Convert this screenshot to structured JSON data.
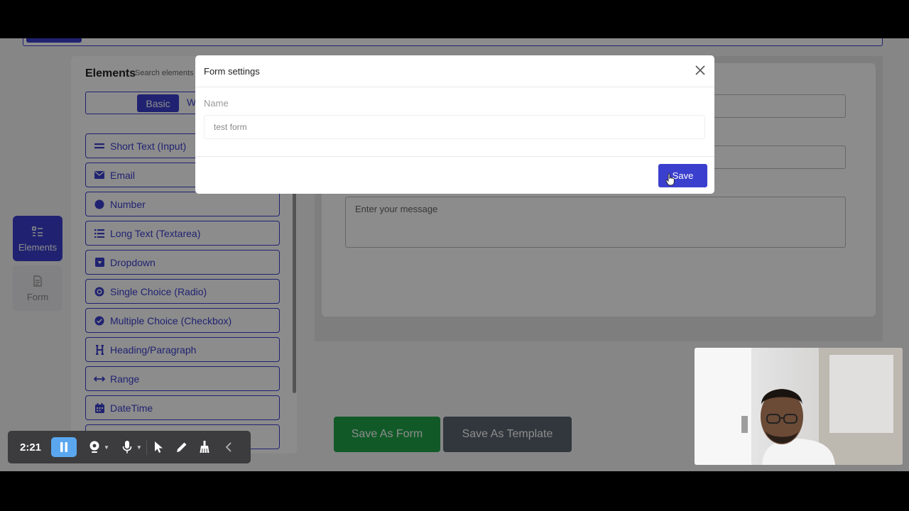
{
  "sidebar_rail": {
    "items": [
      {
        "label": "Elements",
        "icon": "list-icon",
        "active": true
      },
      {
        "label": "Form",
        "icon": "document-icon",
        "active": false
      }
    ]
  },
  "elements_panel": {
    "title": "Elements",
    "search_label": "Search elements",
    "tabs": [
      {
        "label": "Basic",
        "active": true
      },
      {
        "label": "W",
        "active": false
      }
    ],
    "items": [
      {
        "label": "Short Text (Input)",
        "icon": "equals-icon"
      },
      {
        "label": "Email",
        "icon": "envelope-icon"
      },
      {
        "label": "Number",
        "icon": "circle-icon"
      },
      {
        "label": "Long Text (Textarea)",
        "icon": "list-icon"
      },
      {
        "label": "Dropdown",
        "icon": "caret-square-icon"
      },
      {
        "label": "Single Choice (Radio)",
        "icon": "radio-icon"
      },
      {
        "label": "Multiple Choice (Checkbox)",
        "icon": "check-circle-icon"
      },
      {
        "label": "Heading/Paragraph",
        "icon": "heading-icon"
      },
      {
        "label": "Range",
        "icon": "arrows-horizontal-icon"
      },
      {
        "label": "DateTime",
        "icon": "calendar-icon"
      }
    ]
  },
  "form_canvas": {
    "message_placeholder": "Enter your message"
  },
  "actions": {
    "save_as_form": "Save As Form",
    "save_as_template": "Save As Template"
  },
  "modal": {
    "title": "Form settings",
    "name_label": "Name",
    "name_value": "test form",
    "save_label": "Save"
  },
  "recorder": {
    "elapsed": "2:21"
  },
  "colors": {
    "primary": "#3b3fce",
    "success": "#1fa44a",
    "secondary": "#5b6470"
  }
}
